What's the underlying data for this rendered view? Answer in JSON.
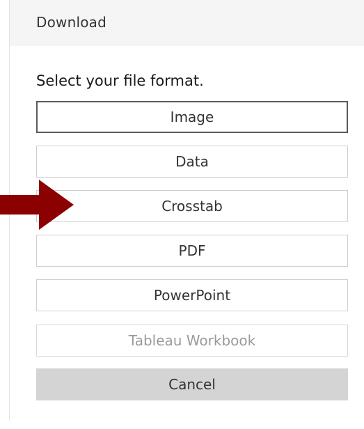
{
  "dialog": {
    "title": "Download",
    "prompt": "Select your file format.",
    "options": [
      {
        "label": "Image",
        "selected": true,
        "enabled": true
      },
      {
        "label": "Data",
        "selected": false,
        "enabled": true
      },
      {
        "label": "Crosstab",
        "selected": false,
        "enabled": true
      },
      {
        "label": "PDF",
        "selected": false,
        "enabled": true
      },
      {
        "label": "PowerPoint",
        "selected": false,
        "enabled": true
      },
      {
        "label": "Tableau Workbook",
        "selected": false,
        "enabled": false
      }
    ],
    "cancel_label": "Cancel"
  },
  "annotation": {
    "arrow_color": "#8b0000",
    "points_to": "Crosstab"
  },
  "colors": {
    "header_bg": "#f5f5f5",
    "cancel_bg": "#d4d4d4",
    "selected_border": "#5a5a5a"
  }
}
